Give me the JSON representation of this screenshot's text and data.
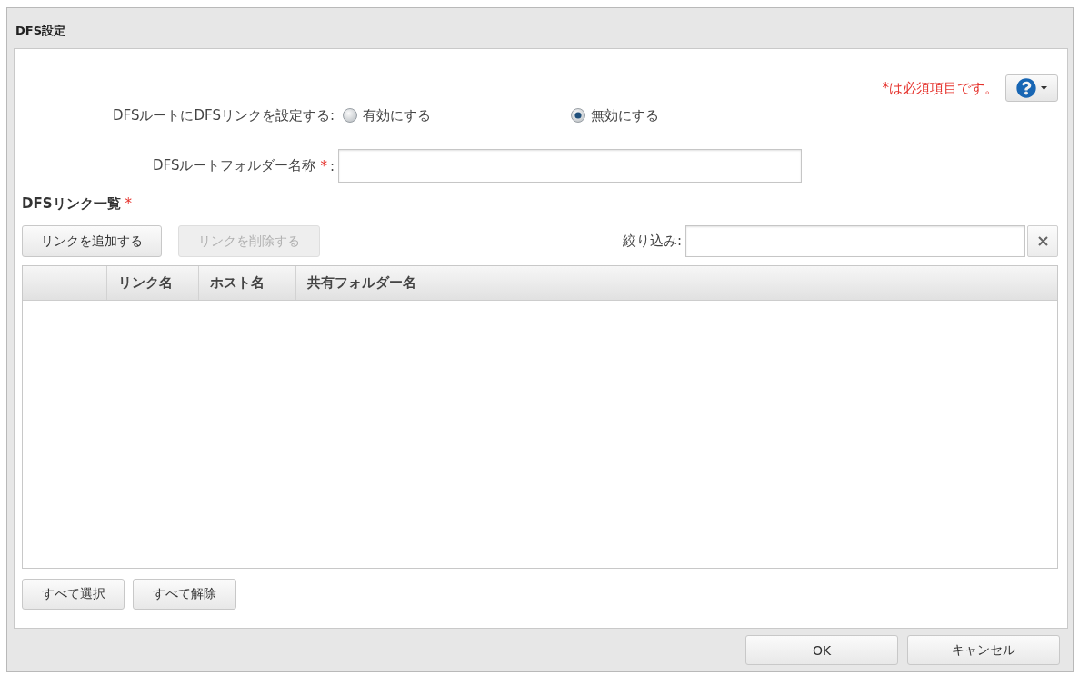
{
  "window": {
    "title": "DFS設定"
  },
  "header": {
    "required_note": "*は必須項目です。"
  },
  "form": {
    "rows": [
      {
        "kind": "radio",
        "label": "DFSルートにDFSリンクを設定する:",
        "options": [
          {
            "label": "有効にする",
            "selected": false
          },
          {
            "label": "無効にする",
            "selected": true
          }
        ]
      },
      {
        "kind": "text",
        "label": "DFSルートフォルダー名称",
        "required_mark": "*",
        "separator": ":"
      }
    ]
  },
  "link_list": {
    "title": "DFSリンク一覧",
    "required_mark": "*",
    "actions": [
      {
        "label": "リンクを追加する",
        "disabled": false
      },
      {
        "label": "リンクを削除する",
        "disabled": true
      }
    ],
    "filter": {
      "label": "絞り込み:"
    },
    "table": {
      "columns": [
        {
          "label": "リンク名"
        },
        {
          "label": "ホスト名"
        },
        {
          "label": "共有フォルダー名"
        }
      ]
    },
    "selection_buttons": [
      {
        "label": "すべて選択"
      },
      {
        "label": "すべて解除"
      }
    ]
  },
  "footer": {
    "buttons": [
      {
        "label": "OK"
      },
      {
        "label": "キャンセル"
      }
    ]
  }
}
